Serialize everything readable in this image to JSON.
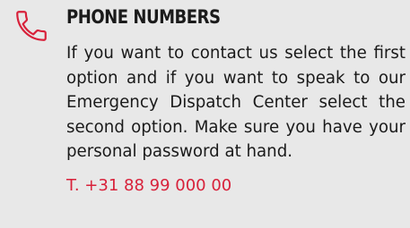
{
  "section": {
    "icon": "phone-icon",
    "title": "PHONE NUMBERS",
    "description": "If you want to contact us select the first option and if you want to speak to our Emergency Dispatch Center select the second option. Make sure you have your personal password at hand.",
    "phone_label": "T. +31 88 99 000 00"
  },
  "colors": {
    "background": "#e8e8e8",
    "accent": "#d8213a",
    "text": "#1a1a1a"
  }
}
